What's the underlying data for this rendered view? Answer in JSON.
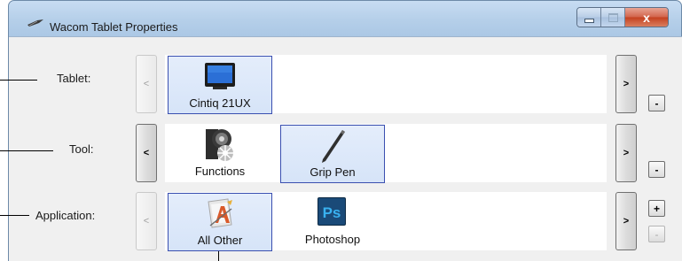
{
  "window": {
    "title": "Wacom Tablet Properties",
    "close_glyph": "x"
  },
  "rows": {
    "tablet": {
      "label": "Tablet:",
      "scroll_left": "<",
      "scroll_right": ">",
      "remove": "-",
      "items": [
        {
          "label": "Cintiq 21UX",
          "icon": "tablet-icon",
          "selected": true
        }
      ]
    },
    "tool": {
      "label": "Tool:",
      "scroll_left": "<",
      "scroll_right": ">",
      "remove": "-",
      "items": [
        {
          "label": "Functions",
          "icon": "functions-icon",
          "selected": false
        },
        {
          "label": "Grip Pen",
          "icon": "pen-icon",
          "selected": true
        }
      ]
    },
    "application": {
      "label": "Application:",
      "scroll_left": "<",
      "scroll_right": ">",
      "add": "+",
      "remove": "-",
      "items": [
        {
          "label": "All Other",
          "icon": "all-other-icon",
          "selected": true
        },
        {
          "label": "Photoshop",
          "icon": "photoshop-icon",
          "selected": false,
          "icon_text": "Ps"
        }
      ]
    }
  },
  "colors": {
    "selection_border": "#3a4fb0",
    "selection_fill": "#dde8f9",
    "titlebar": "#b5cfe9",
    "close_button": "#c4401f"
  }
}
